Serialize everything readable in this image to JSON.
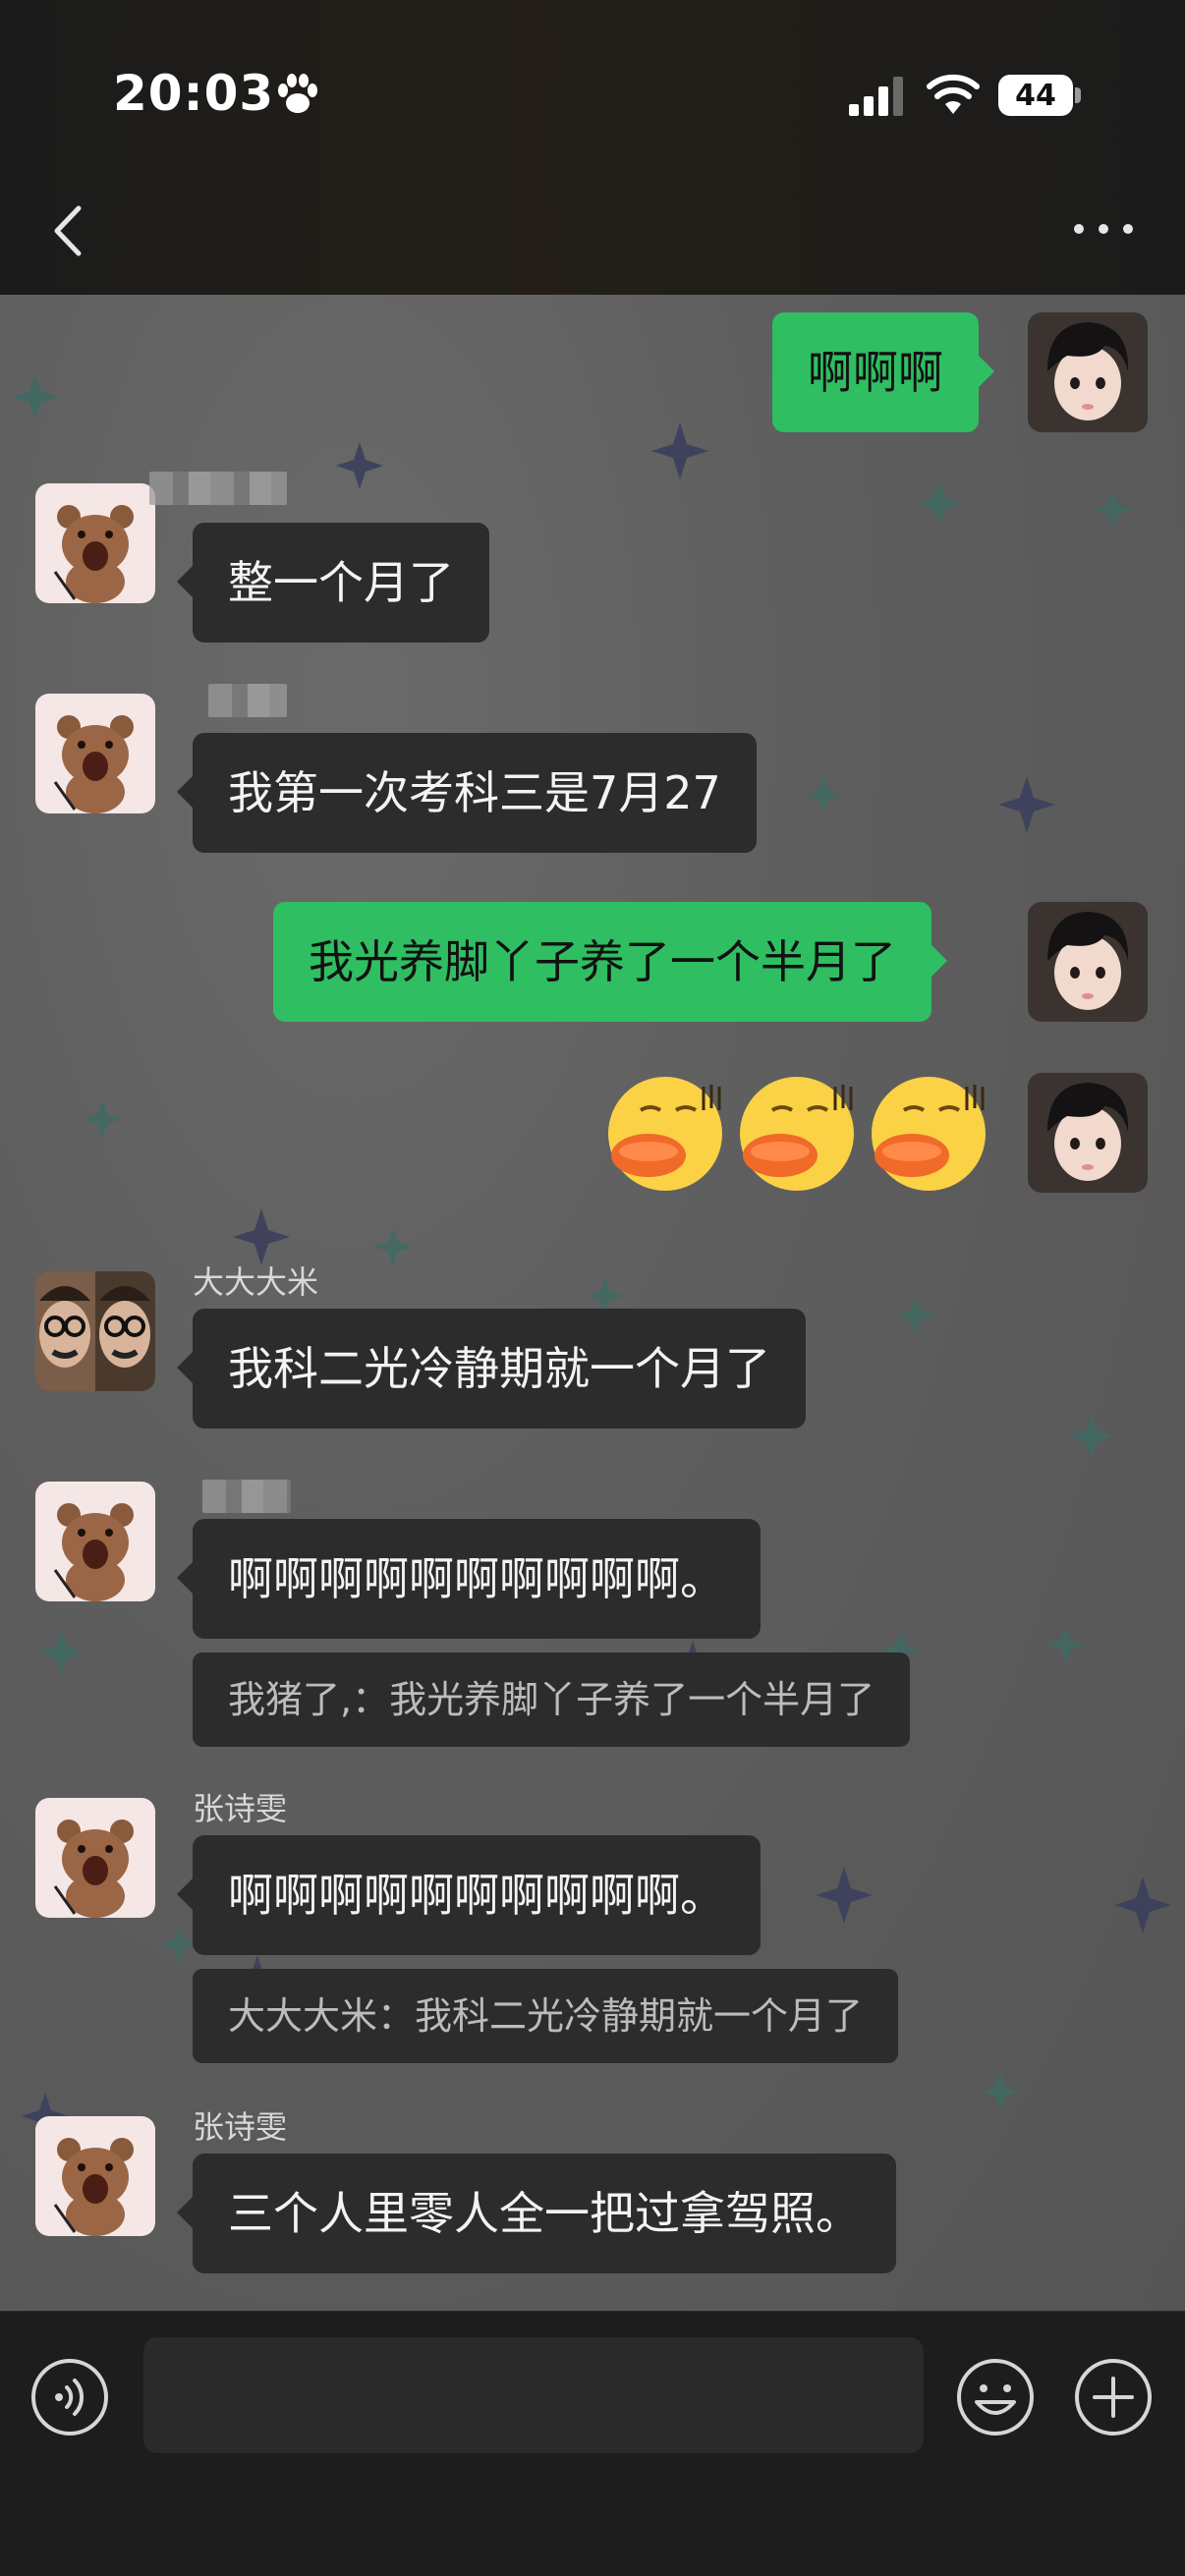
{
  "status_bar": {
    "time": "20:03",
    "battery": "44"
  },
  "nav": {
    "back_icon": "chevron-left-icon",
    "more_icon": "more-horizontal-icon"
  },
  "messages": [
    {
      "side": "right",
      "type": "text",
      "text": "啊啊啊"
    },
    {
      "side": "left",
      "sender": "",
      "type": "text",
      "text": "整一个月了"
    },
    {
      "side": "left",
      "sender": "",
      "type": "text",
      "text": "我第一次考科三是7月27"
    },
    {
      "side": "right",
      "type": "text",
      "text": "我光养脚丫子养了一个半月了"
    },
    {
      "side": "right",
      "type": "emoji",
      "count": 3,
      "emoji": "kissing-face-emoji"
    },
    {
      "side": "left",
      "sender": "大大大米",
      "type": "text",
      "text": "我科二光冷静期就一个月了"
    },
    {
      "side": "left",
      "sender": "",
      "type": "text",
      "text": "啊啊啊啊啊啊啊啊啊啊。",
      "quote": "我猪了,：我光养脚丫子养了一个半月了"
    },
    {
      "side": "left",
      "sender": "张诗雯",
      "type": "text",
      "text": "啊啊啊啊啊啊啊啊啊啊。",
      "quote": "大大大米：我科二光冷静期就一个月了"
    },
    {
      "side": "left",
      "sender": "张诗雯",
      "type": "text",
      "text": "三个人里零人全一把过拿驾照。"
    }
  ],
  "input": {
    "value": "",
    "placeholder": "",
    "voice_icon": "voice-icon",
    "emoji_icon": "emoji-smile-icon",
    "plus_icon": "plus-circle-icon"
  },
  "colors": {
    "my_bubble": "#2fbe62",
    "their_bubble": "#2c2c2c",
    "chat_background": "#5e5e5e",
    "bar_background": "#1d1d1d"
  }
}
